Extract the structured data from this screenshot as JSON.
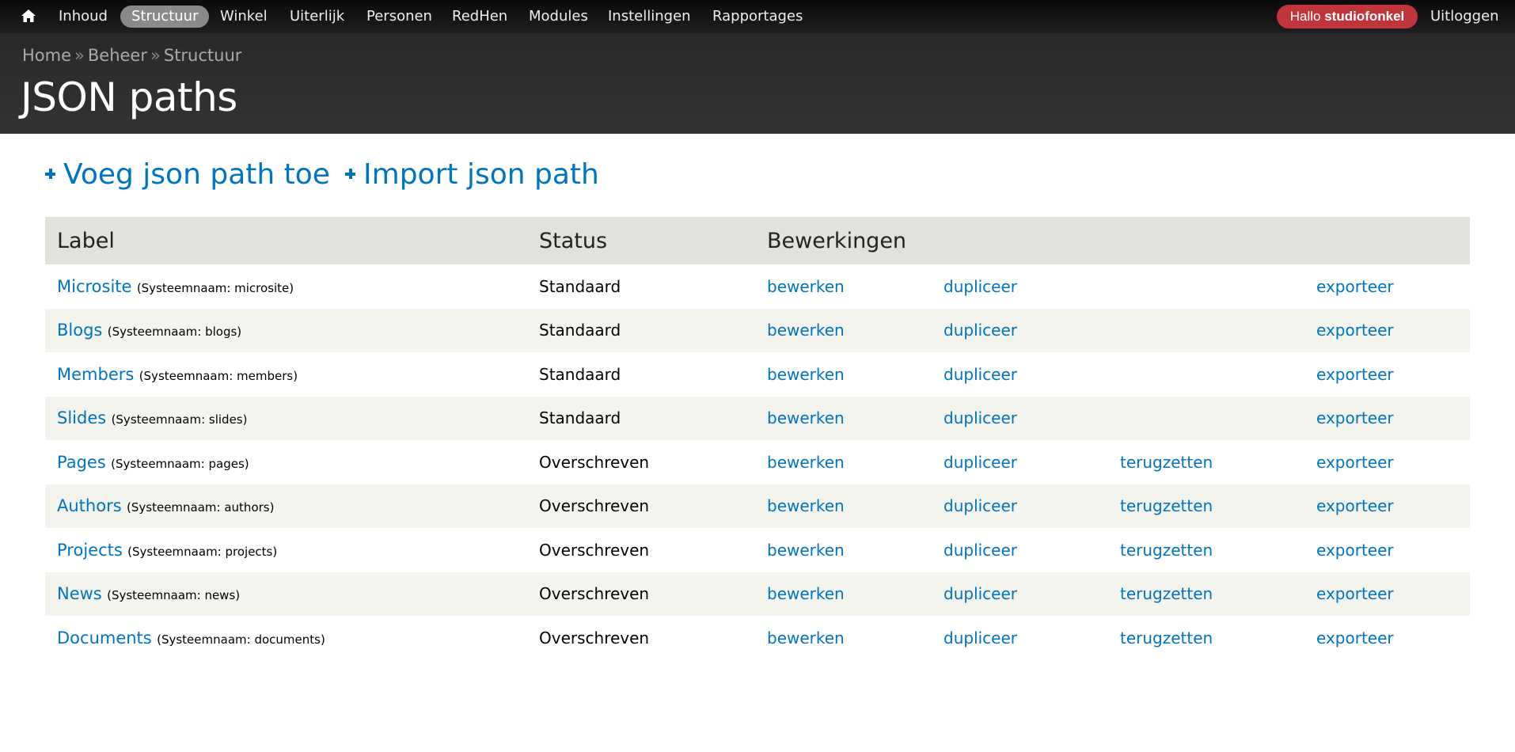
{
  "toolbar": {
    "items": [
      {
        "label": "Inhoud",
        "active": false
      },
      {
        "label": "Structuur",
        "active": true
      },
      {
        "label": "Winkel",
        "active": false
      },
      {
        "label": "Uiterlijk",
        "active": false
      },
      {
        "label": "Personen",
        "active": false
      },
      {
        "label": "RedHen",
        "active": false
      },
      {
        "label": "Modules",
        "active": false
      },
      {
        "label": "Instellingen",
        "active": false
      },
      {
        "label": "Rapportages",
        "active": false
      }
    ],
    "hello_prefix": "Hallo",
    "username": "studiofonkel",
    "logout": "Uitloggen",
    "accent_color": "#c0353c"
  },
  "breadcrumb": [
    "Home",
    "Beheer",
    "Structuur"
  ],
  "page_title": "JSON paths",
  "actions": [
    {
      "label": "Voeg json path toe",
      "icon": "plus-icon"
    },
    {
      "label": "Import json path",
      "icon": "plus-icon"
    }
  ],
  "table": {
    "headers": [
      "Label",
      "Status",
      "Bewerkingen"
    ],
    "rows": [
      {
        "label": "Microsite",
        "machine": "(Systeemnaam: microsite)",
        "status": "Standaard",
        "ops": [
          "bewerken",
          "dupliceer",
          "",
          "exporteer"
        ]
      },
      {
        "label": "Blogs",
        "machine": "(Systeemnaam: blogs)",
        "status": "Standaard",
        "ops": [
          "bewerken",
          "dupliceer",
          "",
          "exporteer"
        ]
      },
      {
        "label": "Members",
        "machine": "(Systeemnaam: members)",
        "status": "Standaard",
        "ops": [
          "bewerken",
          "dupliceer",
          "",
          "exporteer"
        ]
      },
      {
        "label": "Slides",
        "machine": "(Systeemnaam: slides)",
        "status": "Standaard",
        "ops": [
          "bewerken",
          "dupliceer",
          "",
          "exporteer"
        ]
      },
      {
        "label": "Pages",
        "machine": "(Systeemnaam: pages)",
        "status": "Overschreven",
        "ops": [
          "bewerken",
          "dupliceer",
          "terugzetten",
          "exporteer"
        ]
      },
      {
        "label": "Authors",
        "machine": "(Systeemnaam: authors)",
        "status": "Overschreven",
        "ops": [
          "bewerken",
          "dupliceer",
          "terugzetten",
          "exporteer"
        ]
      },
      {
        "label": "Projects",
        "machine": "(Systeemnaam: projects)",
        "status": "Overschreven",
        "ops": [
          "bewerken",
          "dupliceer",
          "terugzetten",
          "exporteer"
        ]
      },
      {
        "label": "News",
        "machine": "(Systeemnaam: news)",
        "status": "Overschreven",
        "ops": [
          "bewerken",
          "dupliceer",
          "terugzetten",
          "exporteer"
        ]
      },
      {
        "label": "Documents",
        "machine": "(Systeemnaam: documents)",
        "status": "Overschreven",
        "ops": [
          "bewerken",
          "dupliceer",
          "terugzetten",
          "exporteer"
        ]
      }
    ]
  },
  "colors": {
    "link": "#0074bd",
    "header_bg": "#2d2d2d",
    "table_header_bg": "#e1e2dc",
    "row_even_bg": "#f3f4ee"
  }
}
